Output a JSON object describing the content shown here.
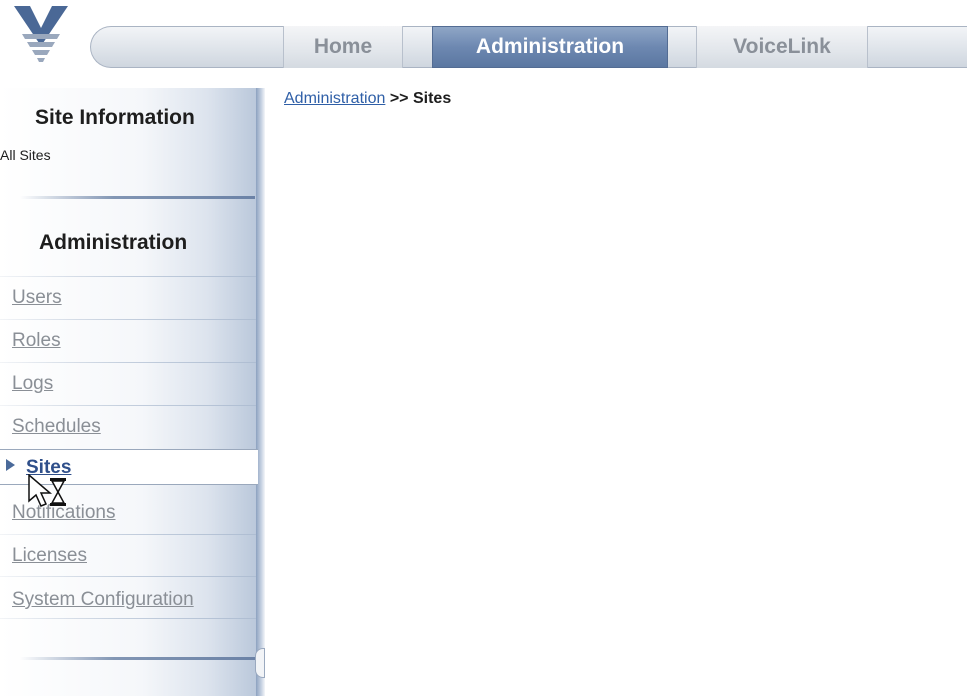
{
  "nav": {
    "tabs": [
      {
        "label": "Home",
        "active": false
      },
      {
        "label": "Administration",
        "active": true
      },
      {
        "label": "VoiceLink",
        "active": false
      }
    ]
  },
  "sidebar": {
    "site_info_title": "Site Information",
    "all_sites": "All Sites",
    "admin_title": "Administration",
    "items": [
      {
        "label": "Users"
      },
      {
        "label": "Roles"
      },
      {
        "label": "Logs"
      },
      {
        "label": "Schedules"
      },
      {
        "label": "Sites",
        "active": true
      },
      {
        "label": "Notifications"
      },
      {
        "label": "Licenses"
      },
      {
        "label": "System Configuration"
      }
    ]
  },
  "breadcrumb": {
    "parent": "Administration",
    "separator": ">>",
    "current": "Sites"
  },
  "colors": {
    "accent": "#6d88b1",
    "link": "#2f5fa7",
    "active_link": "#2f4f8a"
  }
}
